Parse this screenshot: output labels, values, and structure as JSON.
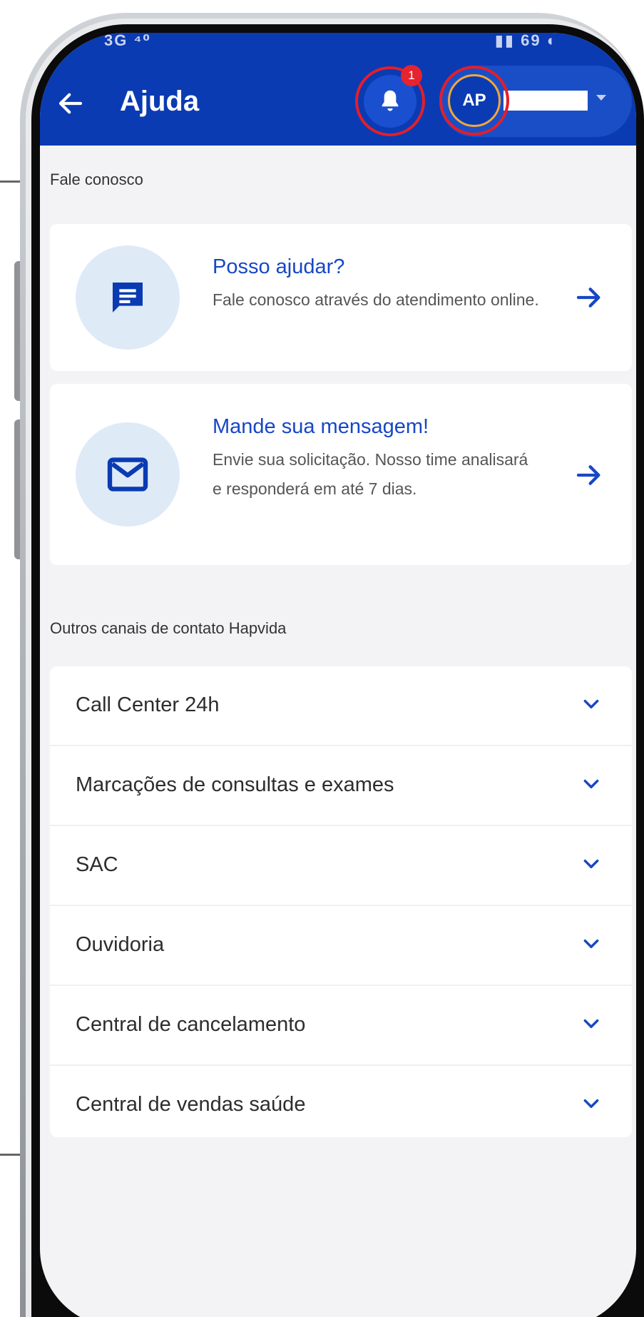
{
  "colors": {
    "header_bg": "#0a3bb3",
    "accent_blue": "#1747c5",
    "screen_bg": "#f3f3f5",
    "badge_red": "#e5242f",
    "icon_circle_bg": "#dfeaf7"
  },
  "status_bar": {
    "left": "3G ⁴⁰",
    "right": "▮▮ 69 ◐"
  },
  "header": {
    "back_icon": "arrow-left-icon",
    "title": "Ajuda",
    "notifications": {
      "icon": "bell-icon",
      "badge": "1"
    },
    "profile": {
      "initials": "AP",
      "dropdown_icon": "caret-down-icon"
    }
  },
  "fale_conosco": {
    "label": "Fale conosco",
    "cards": [
      {
        "icon": "chat-message-icon",
        "title": "Posso ajudar?",
        "description": "Fale conosco através do atendimento online.",
        "arrow_icon": "arrow-right-icon"
      },
      {
        "icon": "envelope-icon",
        "title": "Mande sua mensagem!",
        "description": "Envie sua solicitação. Nosso time analisará e responderá em até 7 dias.",
        "arrow_icon": "arrow-right-icon"
      }
    ]
  },
  "outros_canais": {
    "label": "Outros canais de contato Hapvida",
    "items": [
      {
        "label": "Call Center 24h"
      },
      {
        "label": "Marcações de consultas e exames"
      },
      {
        "label": "SAC"
      },
      {
        "label": "Ouvidoria"
      },
      {
        "label": "Central de cancelamento"
      },
      {
        "label": "Central de vendas saúde"
      }
    ],
    "chevron_icon": "chevron-down-icon"
  }
}
